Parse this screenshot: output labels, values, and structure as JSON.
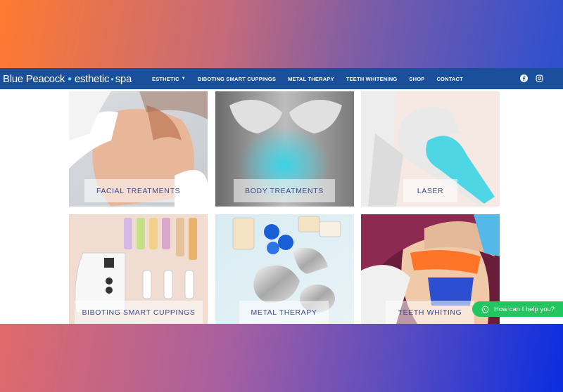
{
  "colors": {
    "navbar": "#1a4f9c",
    "accent": "#7fd3ff",
    "label_text": "#3b4a8a",
    "whatsapp": "#22c55e"
  },
  "logo": {
    "part1": "Blue Peacock",
    "part2": "esthetic",
    "part3": "spa"
  },
  "nav": {
    "items": [
      {
        "label": "ESTHETIC",
        "has_dropdown": true
      },
      {
        "label": "BIBOTING SMART CUPPINGS"
      },
      {
        "label": "METAL THERAPY"
      },
      {
        "label": "TEETH WHITENING"
      },
      {
        "label": "SHOP"
      },
      {
        "label": "CONTACT"
      }
    ],
    "social": [
      "facebook-icon",
      "instagram-icon"
    ]
  },
  "tiles": [
    {
      "label": "FACIAL TREATMENTS"
    },
    {
      "label": "BODY TREATMENTS"
    },
    {
      "label": "LASER"
    },
    {
      "label": "BIBOTING SMART CUPPINGS"
    },
    {
      "label": "METAL THERAPY"
    },
    {
      "label": "TEETH WHITING"
    }
  ],
  "whatsapp": {
    "label": "How can I help you?",
    "icon": "whatsapp-icon"
  }
}
